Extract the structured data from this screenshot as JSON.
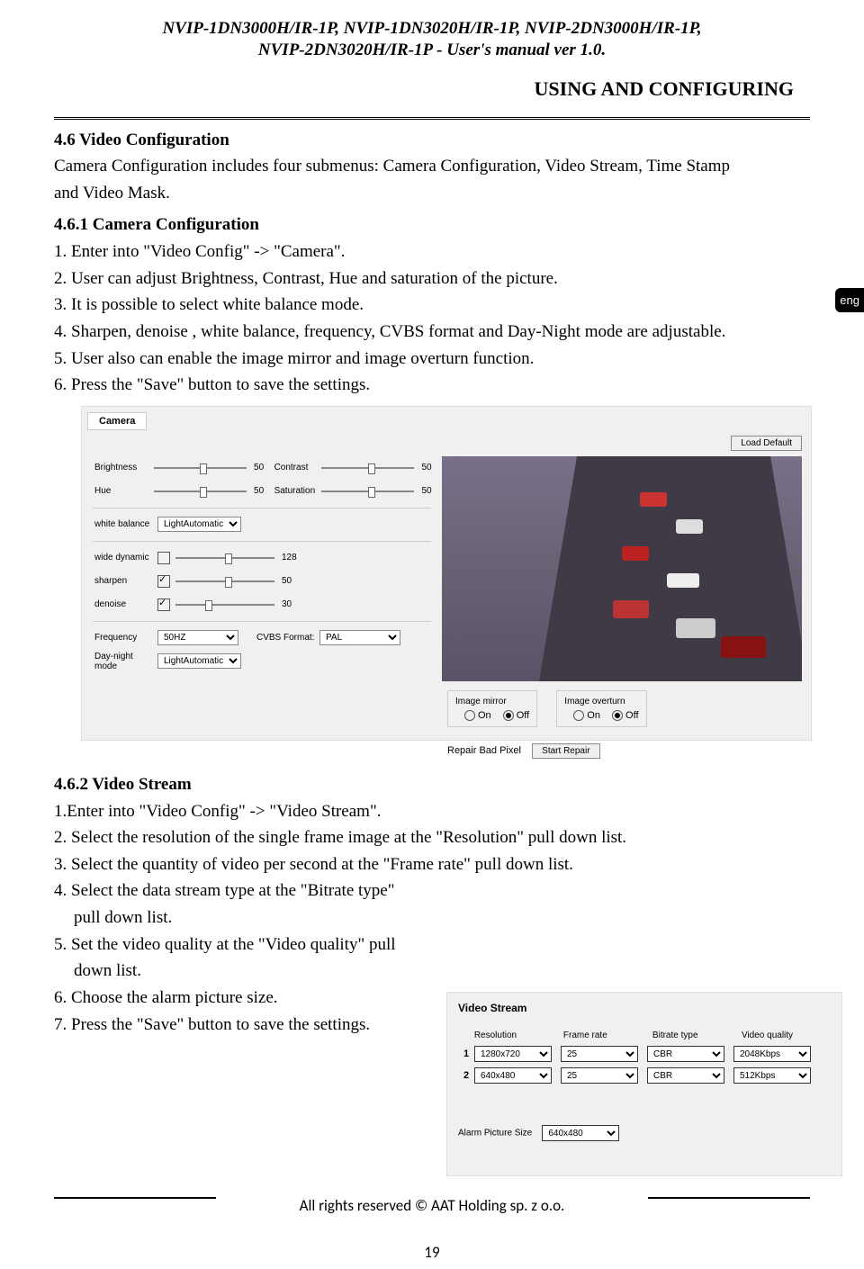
{
  "header": {
    "line1": "NVIP-1DN3000H/IR-1P, NVIP-1DN3020H/IR-1P, NVIP-2DN3000H/IR-1P,",
    "line2": "NVIP-2DN3020H/IR-1P - User's manual ver 1.0."
  },
  "section_title": "USING AND CONFIGURING",
  "lang_tab": "eng",
  "s1": {
    "h": "4.6 Video Configuration",
    "intro1": "Camera Configuration includes four submenus: Camera Configuration, Video Stream, Time Stamp",
    "intro2": "and Video Mask.",
    "sub": "4.6.1 Camera Configuration",
    "l1": "1. Enter into \"Video Config\" ->  \"Camera\".",
    "l2": "2. User can adjust Brightness, Contrast, Hue and saturation of the picture.",
    "l3": "3. It is possible to select white balance mode.",
    "l4": "4. Sharpen, denoise , white balance, frequency, CVBS format and Day-Night mode are adjustable.",
    "l5": "5. User also can enable the image mirror and image overturn function.",
    "l6": "6. Press the \"Save\" button to save the settings."
  },
  "camera": {
    "tab": "Camera",
    "load_default": "Load Default",
    "brightness_lbl": "Brightness",
    "brightness_val": "50",
    "contrast_lbl": "Contrast",
    "contrast_val": "50",
    "hue_lbl": "Hue",
    "hue_val": "50",
    "saturation_lbl": "Saturation",
    "saturation_val": "50",
    "wb_lbl": "white balance",
    "wb_val": "LightAutomatic",
    "wd_lbl": "wide dynamic",
    "wd_val": "128",
    "sharpen_lbl": "sharpen",
    "sharpen_val": "50",
    "denoise_lbl": "denoise",
    "denoise_val": "30",
    "freq_lbl": "Frequency",
    "freq_val": "50HZ",
    "cvbs_lbl": "CVBS Format:",
    "cvbs_val": "PAL",
    "dn_lbl": "Day-night mode",
    "dn_val": "LightAutomatic",
    "mirror_lbl": "Image mirror",
    "overturn_lbl": "Image overturn",
    "on": "On",
    "off": "Off",
    "repair_lbl": "Repair Bad Pixel",
    "repair_btn": "Start Repair"
  },
  "s2": {
    "h": "4.6.2 Video Stream",
    "l1": "1.Enter into \"Video Config\" ->  \"Video Stream\".",
    "l2": "2. Select the resolution of the single frame image at the \"Resolution\" pull down list.",
    "l3": "3. Select the quantity of video per second at the \"Frame rate\" pull down list.",
    "l4a": "4. Select the data stream type at the \"Bitrate type\"",
    "l4b": "pull down list.",
    "l5a": "5. Set the video quality at the \"Video quality\" pull",
    "l5b": "down list.",
    "l6": "6. Choose the alarm picture size.",
    "l7": "7. Press the \"Save\" button to save the settings."
  },
  "vs": {
    "title": "Video Stream",
    "h_res": "Resolution",
    "h_fr": "Frame rate",
    "h_bt": "Bitrate type",
    "h_vq": "Video quality",
    "rows": [
      {
        "idx": "1",
        "res": "1280x720",
        "fr": "25",
        "bt": "CBR",
        "vq": "2048Kbps"
      },
      {
        "idx": "2",
        "res": "640x480",
        "fr": "25",
        "bt": "CBR",
        "vq": "512Kbps"
      }
    ],
    "alarm_lbl": "Alarm Picture Size",
    "alarm_val": "640x480"
  },
  "footer": "All rights reserved © AAT Holding sp. z o.o.",
  "page_num": "19"
}
